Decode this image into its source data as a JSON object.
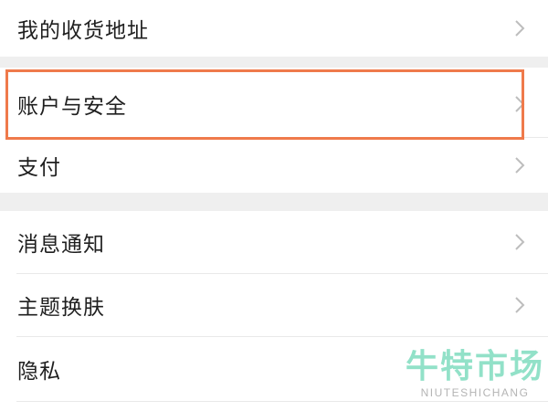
{
  "settings": {
    "items": [
      {
        "label": "我的收货地址",
        "icon": "chevron-right-icon"
      },
      {
        "label": "账户与安全",
        "icon": "chevron-right-icon"
      },
      {
        "label": "支付",
        "icon": "chevron-right-icon"
      },
      {
        "label": "消息通知",
        "icon": "chevron-right-icon"
      },
      {
        "label": "主题换肤",
        "icon": "chevron-right-icon"
      },
      {
        "label": "隐私",
        "icon": "chevron-right-icon"
      }
    ],
    "highlighted_item": "账户与安全"
  },
  "watermark": {
    "title": "牛特市场",
    "subtitle": "NIUTESHICHANG"
  },
  "colors": {
    "highlight": "#ef7a4b",
    "section_gap": "#efefef",
    "watermark": "#7fdcbf"
  }
}
